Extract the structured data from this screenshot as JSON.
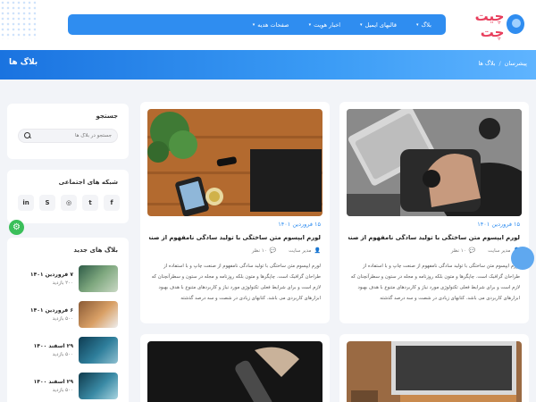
{
  "nav": {
    "items": [
      {
        "label": "بلاگ",
        "caret": "▾"
      },
      {
        "label": "قالبهای ایمیل",
        "caret": "▾"
      },
      {
        "label": "اخبار هویت",
        "caret": "▾"
      },
      {
        "label": "صفحات هدیه",
        "caret": "▾"
      }
    ]
  },
  "logo": {
    "text": "چیت چت"
  },
  "banner": {
    "title": "بلاگ ها",
    "breadcrumb": [
      "پیشرسان",
      "/",
      "بلاگ ها"
    ]
  },
  "sidebar": {
    "search": {
      "title": "جستجو",
      "placeholder": "جستجو در بلاگ ها"
    },
    "social": {
      "title": "شبکه های اجتماعی",
      "icons": [
        "facebook-icon",
        "twitter-icon",
        "instagram-icon",
        "skype-icon",
        "linkedin-icon"
      ],
      "glyphs": [
        "f",
        "t",
        "◎",
        "S",
        "in"
      ]
    },
    "recent": {
      "title": "بلاگ های جدید",
      "items": [
        {
          "date": "۷ فروردین ۱۴۰۱",
          "views": "۲۰۰ بازدید"
        },
        {
          "date": "۶ فروردین ۱۴۰۱",
          "views": "۵۰۰ بازدید"
        },
        {
          "date": "۲۹ اسفند ۱۴۰۰",
          "views": "۵۰۰ بازدید"
        },
        {
          "date": "۲۹ اسفند ۱۴۰۰",
          "views": "۵۰۰ بازدید"
        }
      ]
    }
  },
  "cards": [
    {
      "date": "۱۵ فروردین ۱۴۰۱",
      "title": "لورم ایپسوم متن ساختگی با تولید سادگی نامفهوم از صنعت چاپ",
      "author": "مدیر سایت",
      "comments": "۱۰ نظر",
      "excerpt": "لورم ایپسوم متن ساختگی با تولید سادگی نامفهوم از صنعت چاپ و با استفاده از طراحان گرافیک است. چاپگرها و متون بلکه روزنامه و مجله در ستون و سطرآنچنان که لازم است و برای شرایط فعلی تکنولوژی مورد نیاز و کاربردهای متنوع با هدف بهبود ابزارهای کاربردی می باشد. کتابهای زیادی در شصت و سه درصد گذشته"
    },
    {
      "date": "۱۵ فروردین ۱۴۰۱",
      "title": "لورم ایپسوم متن ساختگی با تولید سادگی نامفهوم از صنعت چاپ",
      "author": "مدیر سایت",
      "comments": "۱۰ نظر",
      "excerpt": "لورم ایپسوم متن ساختگی با تولید سادگی نامفهوم از صنعت چاپ و با استفاده از طراحان گرافیک است. چاپگرها و متون بلکه روزنامه و مجله در ستون و سطرآنچنان که لازم است و برای شرایط فعلی تکنولوژی مورد نیاز و کاربردهای متنوع با هدف بهبود ابزارهای کاربردی می باشد. کتابهای زیادی در شصت و سه درصد گذشته"
    }
  ],
  "colors": {
    "accent": "#2f8df0",
    "logo": "#e83e5c",
    "gear": "#3bbf5a"
  }
}
